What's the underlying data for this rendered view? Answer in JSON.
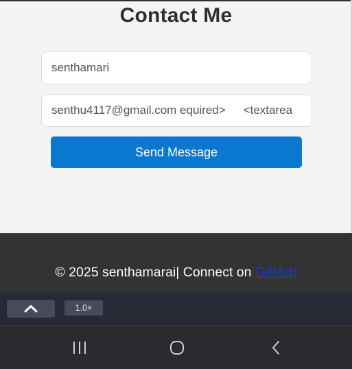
{
  "page": {
    "title": "Contact Me"
  },
  "form": {
    "name_value": "senthamari",
    "email_value": "senthu4117@gmail.com equired>",
    "email_trailing": "<textarea",
    "send_label": "Send Message"
  },
  "footer": {
    "copyright": "© 2025 senthamarai| Connect on ",
    "link_label": "GitHub"
  },
  "toolbar": {
    "collapse_icon": "chevron-up-icon",
    "zoom_label": "1.0×"
  },
  "navbar": {
    "recents_icon": "recents-icon",
    "home_icon": "home-icon",
    "back_icon": "back-icon"
  },
  "colors": {
    "accent": "#0b78d0",
    "footer_bg": "#333333",
    "link": "#1d35e6"
  }
}
